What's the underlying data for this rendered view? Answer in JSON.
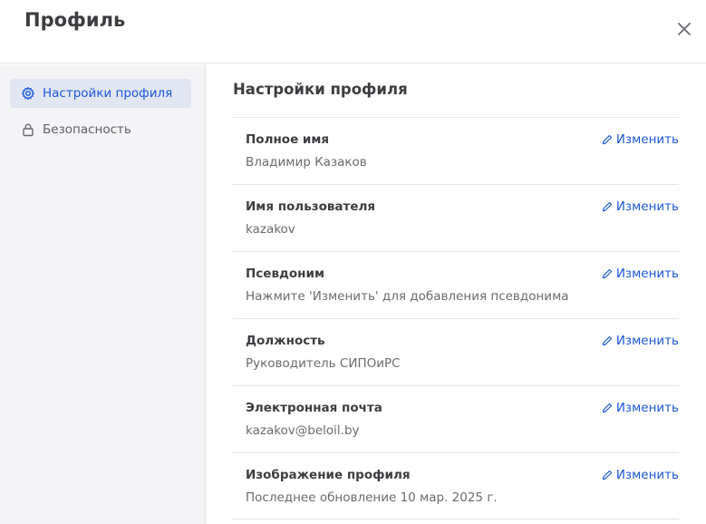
{
  "dialog": {
    "title": "Профиль"
  },
  "sidebar": {
    "items": [
      {
        "label": "Настройки профиля",
        "icon": "gear-icon",
        "active": true
      },
      {
        "label": "Безопасность",
        "icon": "lock-icon",
        "active": false
      }
    ]
  },
  "main": {
    "section_title": "Настройки профиля",
    "edit_label": "Изменить",
    "fields": [
      {
        "label": "Полное имя",
        "value": "Владимир Казаков"
      },
      {
        "label": "Имя пользователя",
        "value": "kazakov"
      },
      {
        "label": "Псевдоним",
        "value": "Нажмите 'Изменить' для добавления псевдонима"
      },
      {
        "label": "Должность",
        "value": "Руководитель СИПОиРС"
      },
      {
        "label": "Электронная почта",
        "value": "kazakov@beloil.by"
      },
      {
        "label": "Изображение профиля",
        "value": "Последнее обновление 10 мар. 2025 г."
      }
    ]
  },
  "colors": {
    "accent": "#1c58d9",
    "active_bg": "#e1e6f2",
    "sidebar_bg": "#f4f4f6"
  }
}
